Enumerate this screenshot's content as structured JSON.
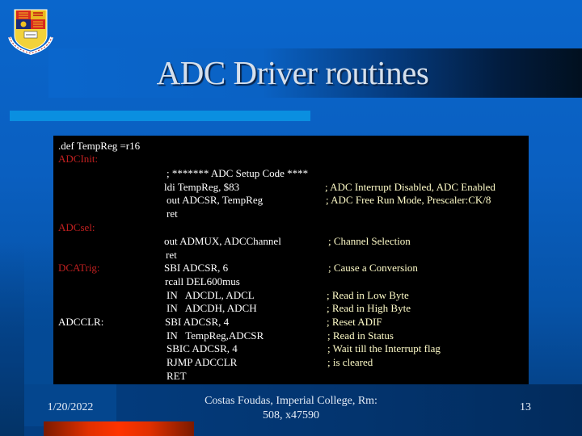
{
  "slide": {
    "title": "ADC Driver routines",
    "logo": "imperial-college-crest-icon",
    "colors": {
      "background": "#0a66cc",
      "accent_bar": "#0a8fe0",
      "code_background": "#000000",
      "label_red": "#c02020",
      "comment_yellow": "#fffcc8",
      "code_white": "#ffffff",
      "footer_red": "#ff3300"
    }
  },
  "code": {
    "lines": [
      {
        "label": ".def TempReg =r16",
        "label_color": "white",
        "instr": "",
        "comment": ""
      },
      {
        "label": "ADCInit:",
        "label_color": "red",
        "instr": "",
        "comment": ""
      },
      {
        "label": "",
        "instr": "; ******* ADC Setup Code ****",
        "comment": ""
      },
      {
        "label": "",
        "instr": "ldi TempReg, $83",
        "comment": "; ADC Interrupt Disabled, ADC Enabled"
      },
      {
        "label": "",
        "instr": "out ADCSR, TempReg",
        "comment": "; ADC Free Run Mode, Prescaler:CK/8"
      },
      {
        "label": "",
        "instr": "ret",
        "comment": ""
      },
      {
        "label": "ADCsel:",
        "label_color": "red",
        "instr": "",
        "comment": ""
      },
      {
        "label": "",
        "instr": "out ADMUX, ADCChannel",
        "comment": "; Channel Selection"
      },
      {
        "label": "",
        "instr": "ret",
        "comment": ""
      },
      {
        "label": "DCATrig:",
        "label_color": "red",
        "instr": "SBI ADCSR, 6",
        "comment": "; Cause a Conversion"
      },
      {
        "label": "",
        "instr": "rcall DEL600mus",
        "comment": ""
      },
      {
        "label": "",
        "instr": "IN   ADCDL, ADCL",
        "comment": "; Read in Low Byte"
      },
      {
        "label": "",
        "instr": "IN   ADCDH, ADCH",
        "comment": "; Read in High Byte"
      },
      {
        "label": "ADCCLR:",
        "label_color": "white",
        "instr": "SBI ADCSR, 4",
        "comment": "; Reset ADIF"
      },
      {
        "label": "",
        "instr": "IN   TempReg,ADCSR",
        "comment": "; Read in Status"
      },
      {
        "label": "",
        "instr": "SBIC ADCSR, 4",
        "comment": "; Wait till the Interrupt flag"
      },
      {
        "label": "",
        "instr": "RJMP ADCCLR",
        "comment": "; is cleared"
      },
      {
        "label": "",
        "instr": "RET",
        "comment": ""
      }
    ]
  },
  "footer": {
    "date": "1/20/2022",
    "author_line1": "Costas Foudas, Imperial College, Rm:",
    "author_line2": "508, x47590",
    "page_number": "13"
  }
}
